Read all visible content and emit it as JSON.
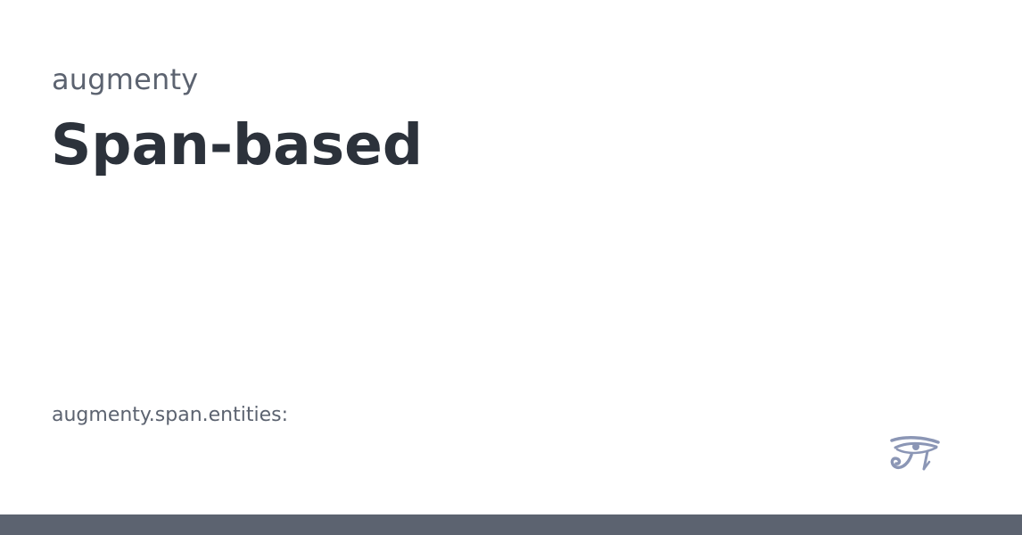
{
  "header": {
    "site_name": "augmenty",
    "title": "Span-based"
  },
  "content": {
    "subtitle": "augmenty.span.entities:"
  },
  "logo": {
    "icon": "eye-of-horus-icon",
    "color": "#8b96b5"
  },
  "footer": {
    "bar_color": "#5c6370"
  }
}
